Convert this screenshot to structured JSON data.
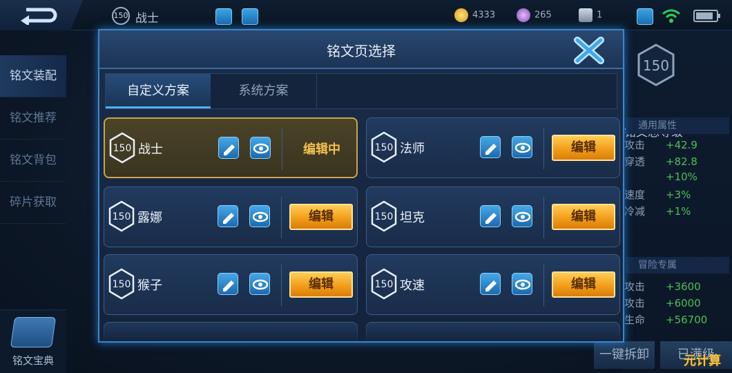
{
  "topbar": {
    "hero_level": "150",
    "hero_name": "战士",
    "gold": "4333",
    "diamonds": "265",
    "vouchers": "1"
  },
  "leftnav": {
    "items": [
      {
        "label": "铭文装配",
        "active": true
      },
      {
        "label": "铭文推荐",
        "active": false
      },
      {
        "label": "铭文背包",
        "active": false
      },
      {
        "label": "碎片获取",
        "active": false
      }
    ],
    "bottom_label": "铭文宝典"
  },
  "rightpanel": {
    "level": "150",
    "title": "铭文总等级",
    "section1": "通用属性",
    "rows1": [
      {
        "k": "攻击",
        "v": "+42.9"
      },
      {
        "k": "穿透",
        "v": "+82.8"
      },
      {
        "k": "",
        "v": "+10%"
      },
      {
        "k": "速度",
        "v": "+3%"
      },
      {
        "k": "冷减",
        "v": "+1%"
      }
    ],
    "section2": "冒险专属",
    "rows2": [
      {
        "k": "攻击",
        "v": "+3600"
      },
      {
        "k": "攻击",
        "v": "+6000"
      },
      {
        "k": "生命",
        "v": "+56700"
      }
    ],
    "btn_dismantle": "一键拆卸",
    "btn_used": "已满级"
  },
  "watermark": "元计算",
  "modal": {
    "title": "铭文页选择",
    "tabs": [
      "自定义方案",
      "系统方案"
    ],
    "pages": [
      {
        "level": "150",
        "name": "战士",
        "action": "编辑中",
        "editing": true
      },
      {
        "level": "150",
        "name": "法师",
        "action": "编辑",
        "editing": false
      },
      {
        "level": "150",
        "name": "露娜",
        "action": "编辑",
        "editing": false
      },
      {
        "level": "150",
        "name": "坦克",
        "action": "编辑",
        "editing": false
      },
      {
        "level": "150",
        "name": "猴子",
        "action": "编辑",
        "editing": false
      },
      {
        "level": "150",
        "name": "攻速",
        "action": "编辑",
        "editing": false
      }
    ]
  },
  "colors": {
    "accent_blue": "#3c86c9",
    "edit_orange": "#f29e1a",
    "editing_gold": "#c8a64a",
    "stat_green": "#4fbf5a"
  }
}
